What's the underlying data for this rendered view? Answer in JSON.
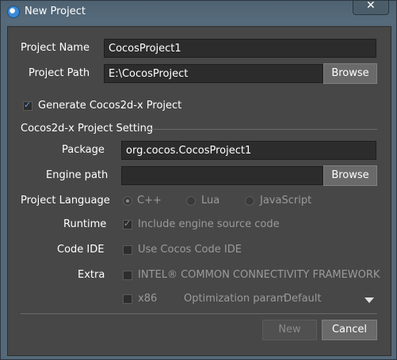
{
  "window": {
    "title": "New Project",
    "close_label": "✕"
  },
  "form": {
    "project_name_label": "Project Name",
    "project_name_value": "CocosProject1",
    "project_path_label": "Project Path",
    "project_path_value": "E:\\CocosProject",
    "browse_label": "Browse",
    "generate_label": "Generate Cocos2d-x Project",
    "generate_checked": true,
    "section_title": "Cocos2d-x Project Setting",
    "package_label": "Package",
    "package_value": "org.cocos.CocosProject1",
    "engine_path_label": "Engine path",
    "engine_path_value": "",
    "engine_browse_label": "Browse",
    "language_label": "Project Language",
    "language_options": [
      "C++",
      "Lua",
      "JavaScript"
    ],
    "language_selected": "C++",
    "runtime_label": "Runtime",
    "runtime_option": "Include engine source code",
    "code_ide_label": "Code IDE",
    "code_ide_option": "Use Cocos Code IDE",
    "extra_label": "Extra",
    "extra_option": "INTEL® COMMON CONNECTIVITY FRAMEWORK",
    "x86_option": "x86",
    "optimization_label": "Optimization param",
    "optimization_value": "Default"
  },
  "footer": {
    "new_label": "New",
    "cancel_label": "Cancel"
  },
  "colors": {
    "accent_check": "#5aa0e8",
    "background": "#474747",
    "title_bar": "#556979"
  }
}
